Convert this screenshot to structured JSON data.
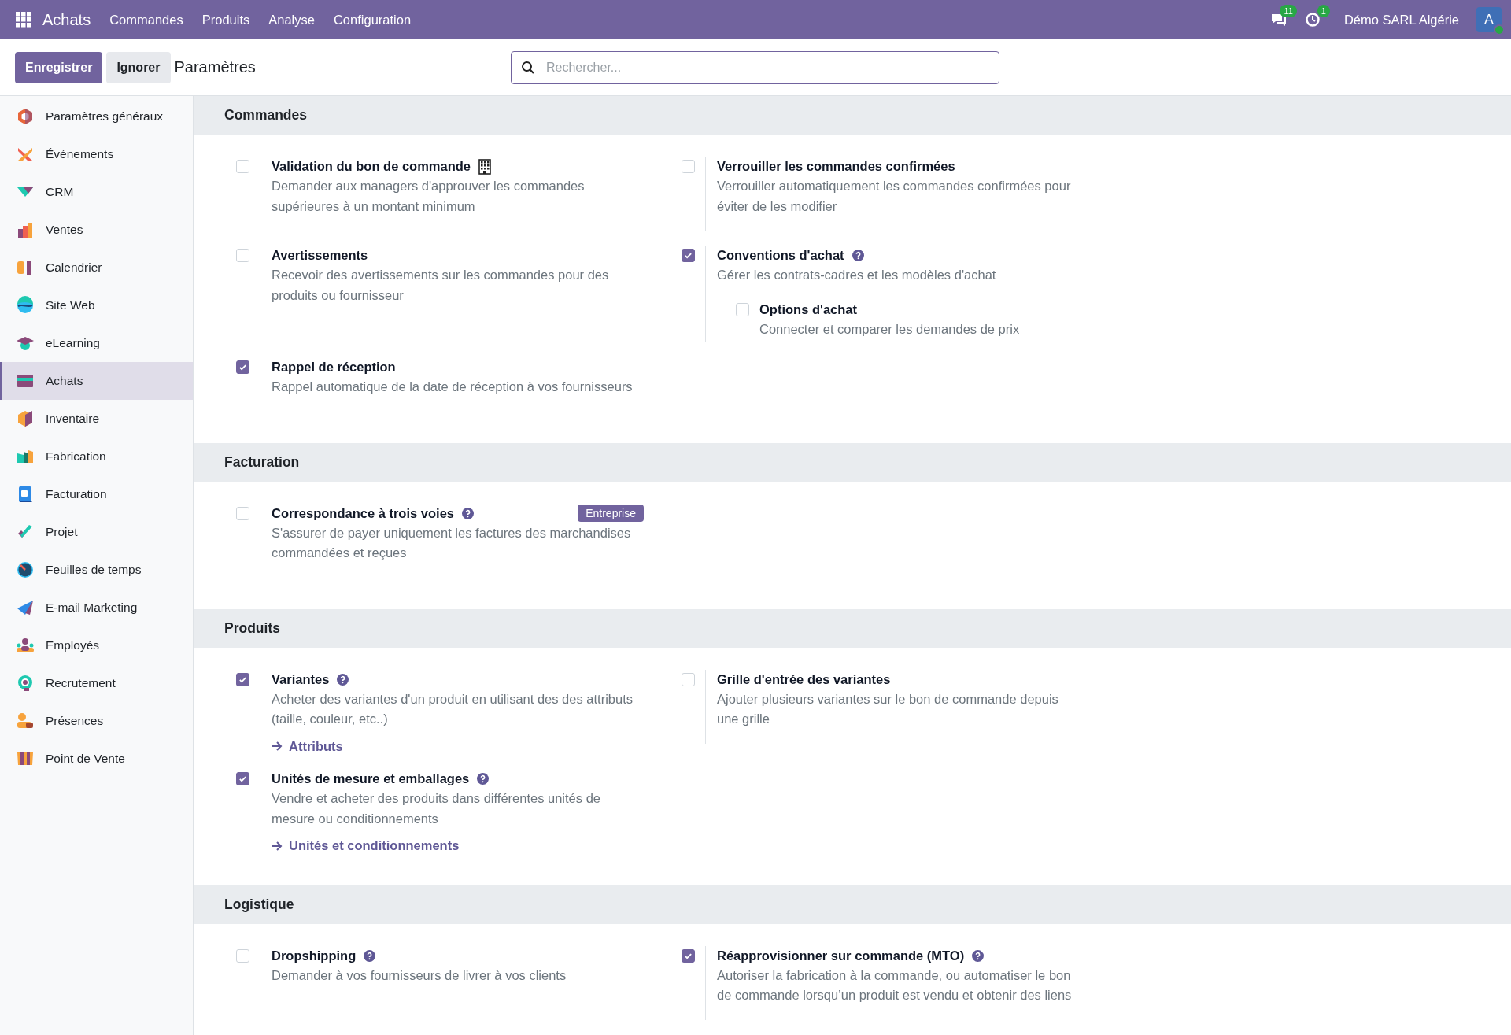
{
  "navbar": {
    "brand": "Achats",
    "menu": [
      "Commandes",
      "Produits",
      "Analyse",
      "Configuration"
    ],
    "messages_badge": "11",
    "activities_badge": "1",
    "company": "Démo SARL Algérie",
    "avatar": "A"
  },
  "control_panel": {
    "save": "Enregistrer",
    "discard": "Ignorer",
    "title": "Paramètres",
    "search": {
      "placeholder": "Rechercher..."
    }
  },
  "sidebar": {
    "items": [
      {
        "label": "Paramètres généraux",
        "selected": false
      },
      {
        "label": "Événements",
        "selected": false
      },
      {
        "label": "CRM",
        "selected": false
      },
      {
        "label": "Ventes",
        "selected": false
      },
      {
        "label": "Calendrier",
        "selected": false
      },
      {
        "label": "Site Web",
        "selected": false
      },
      {
        "label": "eLearning",
        "selected": false
      },
      {
        "label": "Achats",
        "selected": true
      },
      {
        "label": "Inventaire",
        "selected": false
      },
      {
        "label": "Fabrication",
        "selected": false
      },
      {
        "label": "Facturation",
        "selected": false
      },
      {
        "label": "Projet",
        "selected": false
      },
      {
        "label": "Feuilles de temps",
        "selected": false
      },
      {
        "label": "E-mail Marketing",
        "selected": false
      },
      {
        "label": "Employés",
        "selected": false
      },
      {
        "label": "Recrutement",
        "selected": false
      },
      {
        "label": "Présences",
        "selected": false
      },
      {
        "label": "Point de Vente",
        "selected": false
      }
    ]
  },
  "sections": [
    {
      "title": "Commandes",
      "settings": [
        {
          "title": "Validation du bon de commande",
          "description": "Demander aux managers d'approuver les commandes supérieures à un montant minimum",
          "checked": false,
          "help": false,
          "enterprise_icon": true
        },
        {
          "title": "Verrouiller les commandes confirmées",
          "description": "Verrouiller automatiquement les commandes confirmées pour éviter de les modifier",
          "checked": false,
          "help": false
        },
        {
          "title": "Avertissements",
          "description": "Recevoir des avertissements sur les commandes pour des produits ou fournisseur",
          "checked": false,
          "help": false
        },
        {
          "title": "Conventions d'achat",
          "description": "Gérer les contrats-cadres et les modèles d'achat",
          "checked": true,
          "help": true,
          "children": [
            {
              "title": "Options d'achat",
              "description": "Connecter et comparer les demandes de prix",
              "checked": false,
              "help": false
            }
          ]
        },
        {
          "title": "Rappel de réception",
          "description": "Rappel automatique de la date de réception à vos fournisseurs",
          "checked": true,
          "help": false
        }
      ]
    },
    {
      "title": "Facturation",
      "settings": [
        {
          "title": "Correspondance à trois voies",
          "description": "S'assurer de payer uniquement les factures des marchandises commandées et reçues",
          "checked": false,
          "help": true,
          "badge": "Entreprise"
        }
      ]
    },
    {
      "title": "Produits",
      "settings": [
        {
          "title": "Variantes",
          "description": "Acheter des variantes d'un produit en utilisant des des attributs (taille, couleur, etc..)",
          "checked": true,
          "help": true,
          "link": "Attributs"
        },
        {
          "title": "Grille d'entrée des variantes",
          "description": "Ajouter plusieurs variantes sur le bon de commande depuis une grille",
          "checked": false,
          "help": false
        },
        {
          "title": "Unités de mesure et emballages",
          "description": "Vendre et acheter des produits dans différentes unités de mesure ou conditionnements",
          "checked": true,
          "help": true,
          "link": "Unités et conditionnements"
        }
      ]
    },
    {
      "title": "Logistique",
      "settings": [
        {
          "title": "Dropshipping",
          "description": "Demander à vos fournisseurs de livrer à vos clients",
          "checked": false,
          "help": true
        },
        {
          "title": "Réapprovisionner sur commande (MTO)",
          "description": "Autoriser la fabrication à la commande, ou automatiser le bon de commande lorsqu’un produit est vendu et obtenir des liens",
          "checked": true,
          "help": true
        }
      ]
    }
  ]
}
